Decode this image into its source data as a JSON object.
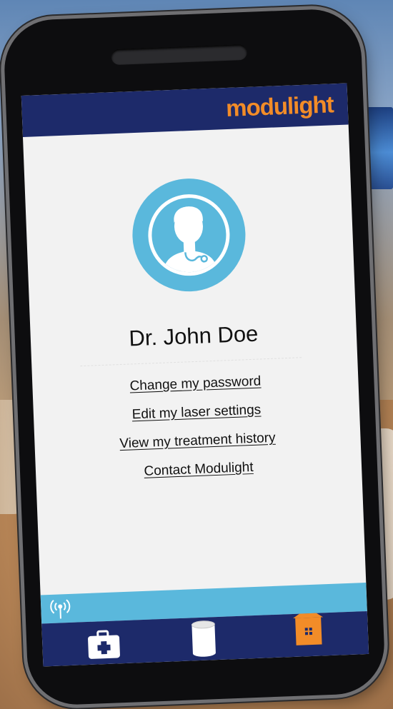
{
  "header": {
    "brand": "modulight"
  },
  "profile": {
    "name": "Dr. John Doe",
    "avatar_icon": "doctor-avatar-icon"
  },
  "menu": {
    "items": [
      {
        "label": "Change my password"
      },
      {
        "label": "Edit my laser settings"
      },
      {
        "label": "View my treatment history"
      },
      {
        "label": "Contact Modulight"
      }
    ]
  },
  "status": {
    "icon": "signal-broadcast-icon"
  },
  "bottom_nav": {
    "items": [
      {
        "icon": "medkit-icon"
      },
      {
        "icon": "cylinder-icon"
      },
      {
        "icon": "home-icon",
        "active": true
      }
    ]
  },
  "colors": {
    "navy": "#1d2a6a",
    "accent_orange": "#f28c28",
    "light_blue": "#5ab8dc",
    "screen_bg": "#f2f2f2"
  }
}
